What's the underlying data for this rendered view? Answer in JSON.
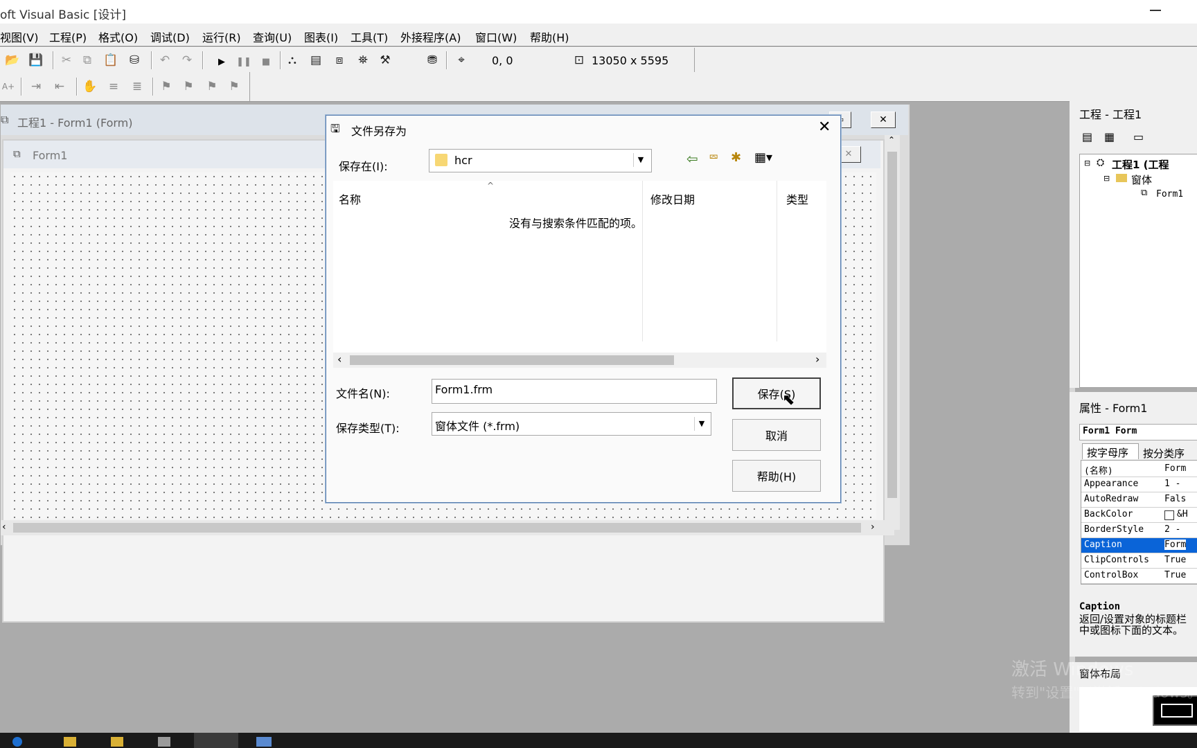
{
  "app": {
    "title": "oft Visual Basic [设计]"
  },
  "menu": [
    "视图(V)",
    "工程(P)",
    "格式(O)",
    "调试(D)",
    "运行(R)",
    "查询(U)",
    "图表(I)",
    "工具(T)",
    "外接程序(A)",
    "窗口(W)",
    "帮助(H)"
  ],
  "toolbar": {
    "position": "0, 0",
    "size": "13050 x 5595"
  },
  "mdi_window": {
    "title": "工程1 - Form1 (Form)"
  },
  "form": {
    "caption": "Form1"
  },
  "dialog": {
    "title": "文件另存为",
    "save_in_label": "保存在(I):",
    "save_in_value": "hcr",
    "columns": [
      "名称",
      "修改日期",
      "类型"
    ],
    "empty_message": "没有与搜索条件匹配的项。",
    "filename_label": "文件名(N):",
    "filename_value": "Form1.frm",
    "filetype_label": "保存类型(T):",
    "filetype_value": "窗体文件 (*.frm)",
    "save_button": "保存(S)",
    "cancel_button": "取消",
    "help_button": "帮助(H)"
  },
  "project_panel": {
    "title": "工程 - 工程1",
    "tree": {
      "root": "工程1 (工程",
      "folder": "窗体",
      "item": "Form1"
    }
  },
  "properties_panel": {
    "title": "属性 - Form1",
    "object": "Form1 Form",
    "tabs": [
      "按字母序",
      "按分类序"
    ],
    "rows": [
      {
        "name": "(名称)",
        "value": "Form"
      },
      {
        "name": "Appearance",
        "value": "1 -"
      },
      {
        "name": "AutoRedraw",
        "value": "Fals"
      },
      {
        "name": "BackColor",
        "value": "&H"
      },
      {
        "name": "BorderStyle",
        "value": "2 -"
      },
      {
        "name": "Caption",
        "value": "Form"
      },
      {
        "name": "ClipControls",
        "value": "True"
      },
      {
        "name": "ControlBox",
        "value": "True"
      }
    ],
    "selected_row": "Caption",
    "description_title": "Caption",
    "description_text": "返回/设置对象的标题栏中或图标下面的文本。"
  },
  "layout_panel": {
    "title": "窗体布局"
  },
  "watermark": {
    "line1": "激活 Windows",
    "line2": "转到\"设置\"以激活 Windows。"
  },
  "colors": {
    "accent": "#0078d7",
    "selection": "#0a64d8"
  }
}
